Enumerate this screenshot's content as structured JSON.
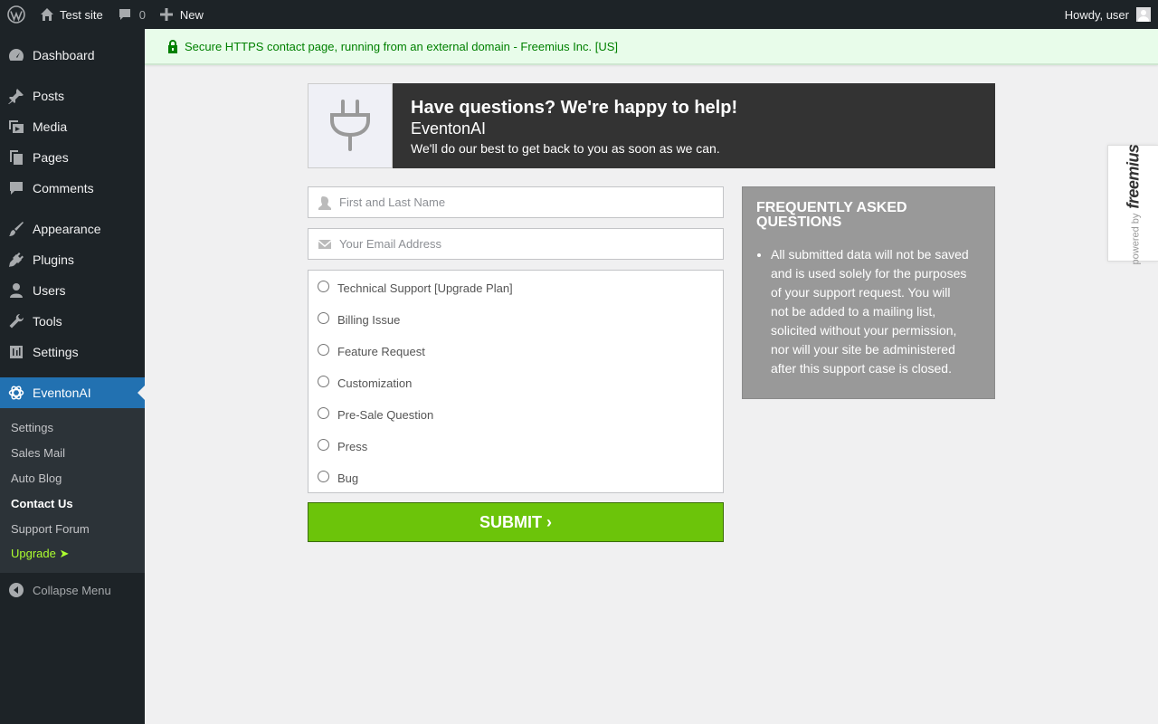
{
  "adminbar": {
    "site_name": "Test site",
    "comments_count": "0",
    "new_label": "New",
    "howdy": "Howdy, user"
  },
  "sidebar": {
    "items": [
      {
        "label": "Dashboard",
        "icon": "dashboard-icon"
      },
      {
        "label": "Posts",
        "icon": "pin-icon"
      },
      {
        "label": "Media",
        "icon": "media-icon"
      },
      {
        "label": "Pages",
        "icon": "pages-icon"
      },
      {
        "label": "Comments",
        "icon": "comment-icon"
      },
      {
        "label": "Appearance",
        "icon": "brush-icon"
      },
      {
        "label": "Plugins",
        "icon": "plug-icon"
      },
      {
        "label": "Users",
        "icon": "user-icon"
      },
      {
        "label": "Tools",
        "icon": "wrench-icon"
      },
      {
        "label": "Settings",
        "icon": "settings-icon"
      },
      {
        "label": "EventonAI",
        "icon": "openai-icon"
      }
    ],
    "submenu": [
      {
        "label": "Settings"
      },
      {
        "label": "Sales Mail"
      },
      {
        "label": "Auto Blog"
      },
      {
        "label": "Contact Us"
      },
      {
        "label": "Support Forum"
      },
      {
        "label": "Upgrade ➤"
      }
    ],
    "collapse_label": "Collapse Menu"
  },
  "notice": {
    "text": "Secure HTTPS contact page, running from an external domain - Freemius Inc. [US]",
    "color": "#008000"
  },
  "header": {
    "title": "Have questions? We're happy to help!",
    "plugin_name": "EventonAI",
    "subtitle": "We'll do our best to get back to you as soon as we can."
  },
  "form": {
    "name_placeholder": "First and Last Name",
    "email_placeholder": "Your Email Address",
    "topics": [
      "Technical Support [Upgrade Plan]",
      "Billing Issue",
      "Feature Request",
      "Customization",
      "Pre-Sale Question",
      "Press",
      "Bug"
    ],
    "submit_label": "SUBMIT ›",
    "submit_color": "#6cc40a"
  },
  "faq": {
    "title": "FREQUENTLY ASKED QUESTIONS",
    "items": [
      "All submitted data will not be saved and is used solely for the purposes of your support request. You will not be added to a mailing list, solicited without your permission, nor will your site be administered after this support case is closed."
    ]
  },
  "powered_by": {
    "small": "powered by",
    "brand": "freemius"
  },
  "colors": {
    "admin_bg": "#1d2327",
    "accent": "#2271b1",
    "upgrade": "#adff2f"
  }
}
